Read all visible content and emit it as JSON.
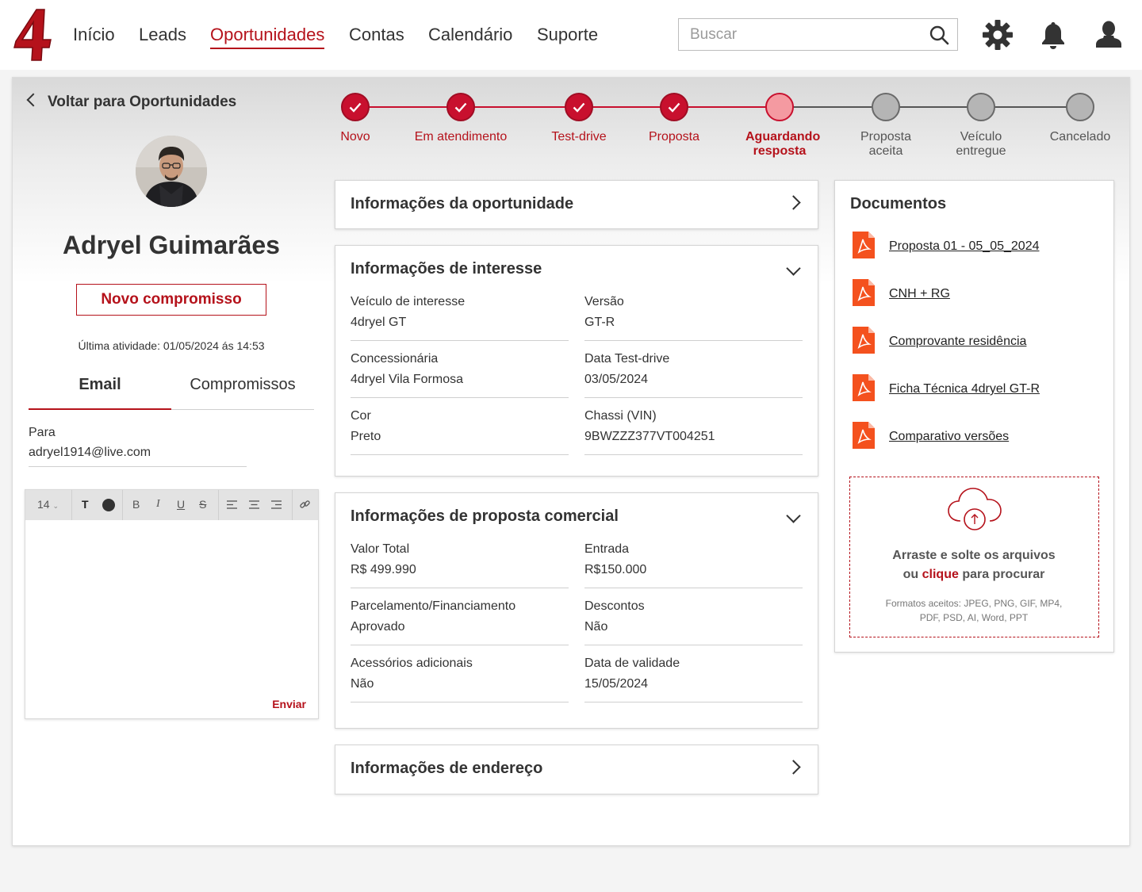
{
  "header": {
    "nav": [
      "Início",
      "Leads",
      "Oportunidades",
      "Contas",
      "Calendário",
      "Suporte"
    ],
    "active_nav": "Oportunidades",
    "search_placeholder": "Buscar",
    "brand_color": "#b5121b"
  },
  "sidebar": {
    "back_label": "Voltar para Oportunidades",
    "lead_name": "Adryel Guimarães",
    "new_commitment_label": "Novo compromisso",
    "last_activity": "Última atividade: 01/05/2024 ás 14:53",
    "tabs": [
      "Email",
      "Compromissos"
    ],
    "active_tab": "Email",
    "to_label": "Para",
    "to_value": "adryel1914@live.com",
    "editor": {
      "font_size": "14",
      "send_label": "Enviar"
    }
  },
  "stepper": {
    "steps": [
      {
        "label": "Novo",
        "state": "done"
      },
      {
        "label": "Em atendimento",
        "state": "done"
      },
      {
        "label": "Test-drive",
        "state": "done"
      },
      {
        "label": "Proposta",
        "state": "done"
      },
      {
        "label": "Aguardando resposta",
        "state": "current"
      },
      {
        "label": "Proposta aceita",
        "state": "pending"
      },
      {
        "label": "Veículo entregue",
        "state": "pending"
      },
      {
        "label": "Cancelado",
        "state": "pending"
      }
    ]
  },
  "panels": {
    "oportunidade": {
      "title": "Informações da oportunidade"
    },
    "interesse": {
      "title": "Informações de interesse",
      "fields": [
        {
          "label": "Veículo de interesse",
          "value": "4dryel GT"
        },
        {
          "label": "Versão",
          "value": "GT-R"
        },
        {
          "label": "Concessionária",
          "value": "4dryel Vila Formosa"
        },
        {
          "label": "Data Test-drive",
          "value": "03/05/2024"
        },
        {
          "label": "Cor",
          "value": "Preto"
        },
        {
          "label": "Chassi (VIN)",
          "value": "9BWZZZ377VT004251"
        }
      ]
    },
    "proposta": {
      "title": "Informações de proposta comercial",
      "fields": [
        {
          "label": "Valor Total",
          "value": "R$ 499.990"
        },
        {
          "label": "Entrada",
          "value": "R$150.000"
        },
        {
          "label": "Parcelamento/Financiamento",
          "value": "Aprovado"
        },
        {
          "label": "Descontos",
          "value": "Não"
        },
        {
          "label": "Acessórios adicionais",
          "value": "Não"
        },
        {
          "label": "Data de validade",
          "value": "15/05/2024"
        }
      ]
    },
    "endereco": {
      "title": "Informações de endereço"
    }
  },
  "documents": {
    "title": "Documentos",
    "items": [
      "Proposta 01 - 05_05_2024",
      "CNH + RG",
      "Comprovante residência",
      "Ficha Técnica 4dryel GT-R",
      "Comparativo versões"
    ],
    "dropzone": {
      "line1": "Arraste e solte os arquivos",
      "line2_pre": "ou",
      "line2_link": "clique",
      "line2_post": "para procurar",
      "formats_line1": "Formatos aceitos: JPEG, PNG, GIF, MP4,",
      "formats_line2": "PDF, PSD, AI, Word, PPT"
    }
  }
}
